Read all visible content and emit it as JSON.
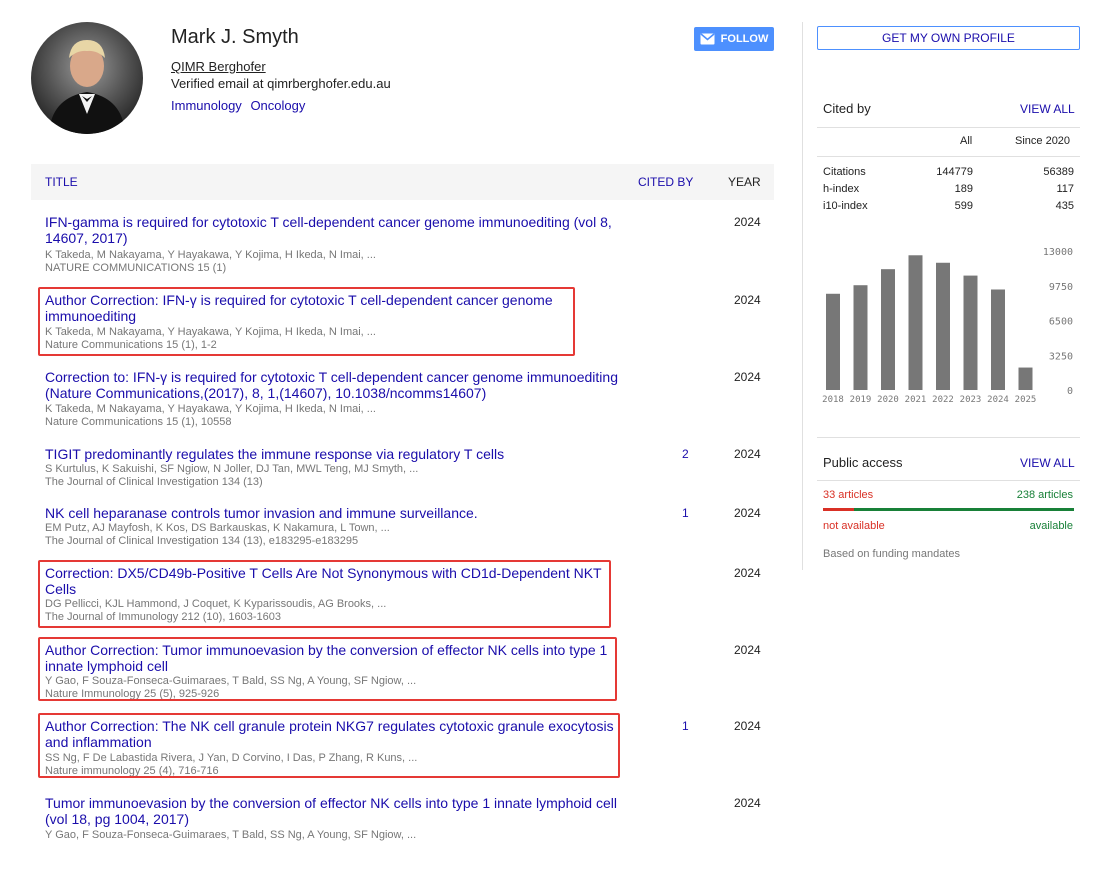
{
  "profile": {
    "name": "Mark J. Smyth",
    "affiliation": "QIMR Berghofer",
    "verified": "Verified email at qimrberghofer.edu.au",
    "interests": [
      "Immunology",
      "Oncology"
    ],
    "follow_label": "FOLLOW"
  },
  "table": {
    "headers": {
      "title": "TITLE",
      "cited_by": "CITED BY",
      "year": "YEAR"
    },
    "rows": [
      {
        "title": "IFN-gamma is required for cytotoxic T cell-dependent cancer genome immunoediting (vol 8, 14607, 2017)",
        "authors": "K Takeda, M Nakayama, Y Hayakawa, Y Kojima, H Ikeda, N Imai, ...",
        "venue": "NATURE COMMUNICATIONS 15 (1)",
        "cited": "",
        "year": "2024"
      },
      {
        "title": "Author Correction: IFN-γ is required for cytotoxic T cell-dependent cancer genome immunoediting",
        "authors": "K Takeda, M Nakayama, Y Hayakawa, Y Kojima, H Ikeda, N Imai, ...",
        "venue": "Nature Communications 15 (1), 1-2",
        "cited": "",
        "year": "2024"
      },
      {
        "title": "Correction to: IFN-γ is required for cytotoxic T cell-dependent cancer genome immunoediting (Nature Communications,(2017), 8, 1,(14607), 10.1038/ncomms14607)",
        "authors": "K Takeda, M Nakayama, Y Hayakawa, Y Kojima, H Ikeda, N Imai, ...",
        "venue": "Nature Communications 15 (1), 10558",
        "cited": "",
        "year": "2024"
      },
      {
        "title": "TIGIT predominantly regulates the immune response via regulatory T cells",
        "authors": "S Kurtulus, K Sakuishi, SF Ngiow, N Joller, DJ Tan, MWL Teng, MJ Smyth, ...",
        "venue": "The Journal of Clinical Investigation 134 (13)",
        "cited": "2",
        "year": "2024"
      },
      {
        "title": "NK cell heparanase controls tumor invasion and immune surveillance.",
        "authors": "EM Putz, AJ Mayfosh, K Kos, DS Barkauskas, K Nakamura, L Town, ...",
        "venue": "The Journal of Clinical Investigation 134 (13), e183295-e183295",
        "cited": "1",
        "year": "2024"
      },
      {
        "title": "Correction: DX5/CD49b-Positive T Cells Are Not Synonymous with CD1d-Dependent NKT Cells",
        "authors": "DG Pellicci, KJL Hammond, J Coquet, K Kyparissoudis, AG Brooks, ...",
        "venue": "The Journal of Immunology 212 (10), 1603-1603",
        "cited": "",
        "year": "2024"
      },
      {
        "title": "Author Correction: Tumor immunoevasion by the conversion of effector NK cells into type 1 innate lymphoid cell",
        "authors": "Y Gao, F Souza-Fonseca-Guimaraes, T Bald, SS Ng, A Young, SF Ngiow, ...",
        "venue": "Nature Immunology 25 (5), 925-926",
        "cited": "",
        "year": "2024"
      },
      {
        "title": "Author Correction: The NK cell granule protein NKG7 regulates cytotoxic granule exocytosis and inflammation",
        "authors": "SS Ng, F De Labastida Rivera, J Yan, D Corvino, I Das, P Zhang, R Kuns, ...",
        "venue": "Nature immunology 25 (4), 716-716",
        "cited": "1",
        "year": "2024"
      },
      {
        "title": "Tumor immunoevasion by the conversion of effector NK cells into type 1 innate lymphoid cell (vol 18, pg 1004, 2017)",
        "authors": "Y Gao, F Souza-Fonseca-Guimaraes, T Bald, SS Ng, A Young, SF Ngiow, ...",
        "venue": "",
        "cited": "",
        "year": "2024"
      }
    ]
  },
  "sidebar": {
    "own_profile_label": "GET MY OWN PROFILE",
    "cited_by": {
      "title": "Cited by",
      "view_all": "VIEW ALL",
      "col_all": "All",
      "col_since": "Since 2020",
      "metrics": [
        {
          "label": "Citations",
          "all": "144779",
          "since": "56389"
        },
        {
          "label": "h-index",
          "all": "189",
          "since": "117"
        },
        {
          "label": "i10-index",
          "all": "599",
          "since": "435"
        }
      ]
    },
    "public_access": {
      "title": "Public access",
      "view_all": "VIEW ALL",
      "not_available_count": "33 articles",
      "available_count": "238 articles",
      "not_available_label": "not available",
      "available_label": "available",
      "mandates": "Based on funding mandates",
      "not_available_fraction": 0.122
    }
  },
  "chart_data": {
    "type": "bar",
    "categories": [
      "2018",
      "2019",
      "2020",
      "2021",
      "2022",
      "2023",
      "2024",
      "2025"
    ],
    "values": [
      9000,
      9800,
      11300,
      12600,
      11900,
      10700,
      9400,
      2100
    ],
    "ylim": [
      0,
      13000
    ],
    "yticks": [
      "13000",
      "9750",
      "6500",
      "3250",
      "0"
    ],
    "bar_color": "#777777"
  },
  "colors": {
    "link": "#1a0dab",
    "follow_bg": "#4d90fe",
    "highlight": "#e53935",
    "not_available": "#d93025",
    "available": "#188038"
  },
  "highlighted_rows": [
    1,
    5,
    6,
    7
  ]
}
